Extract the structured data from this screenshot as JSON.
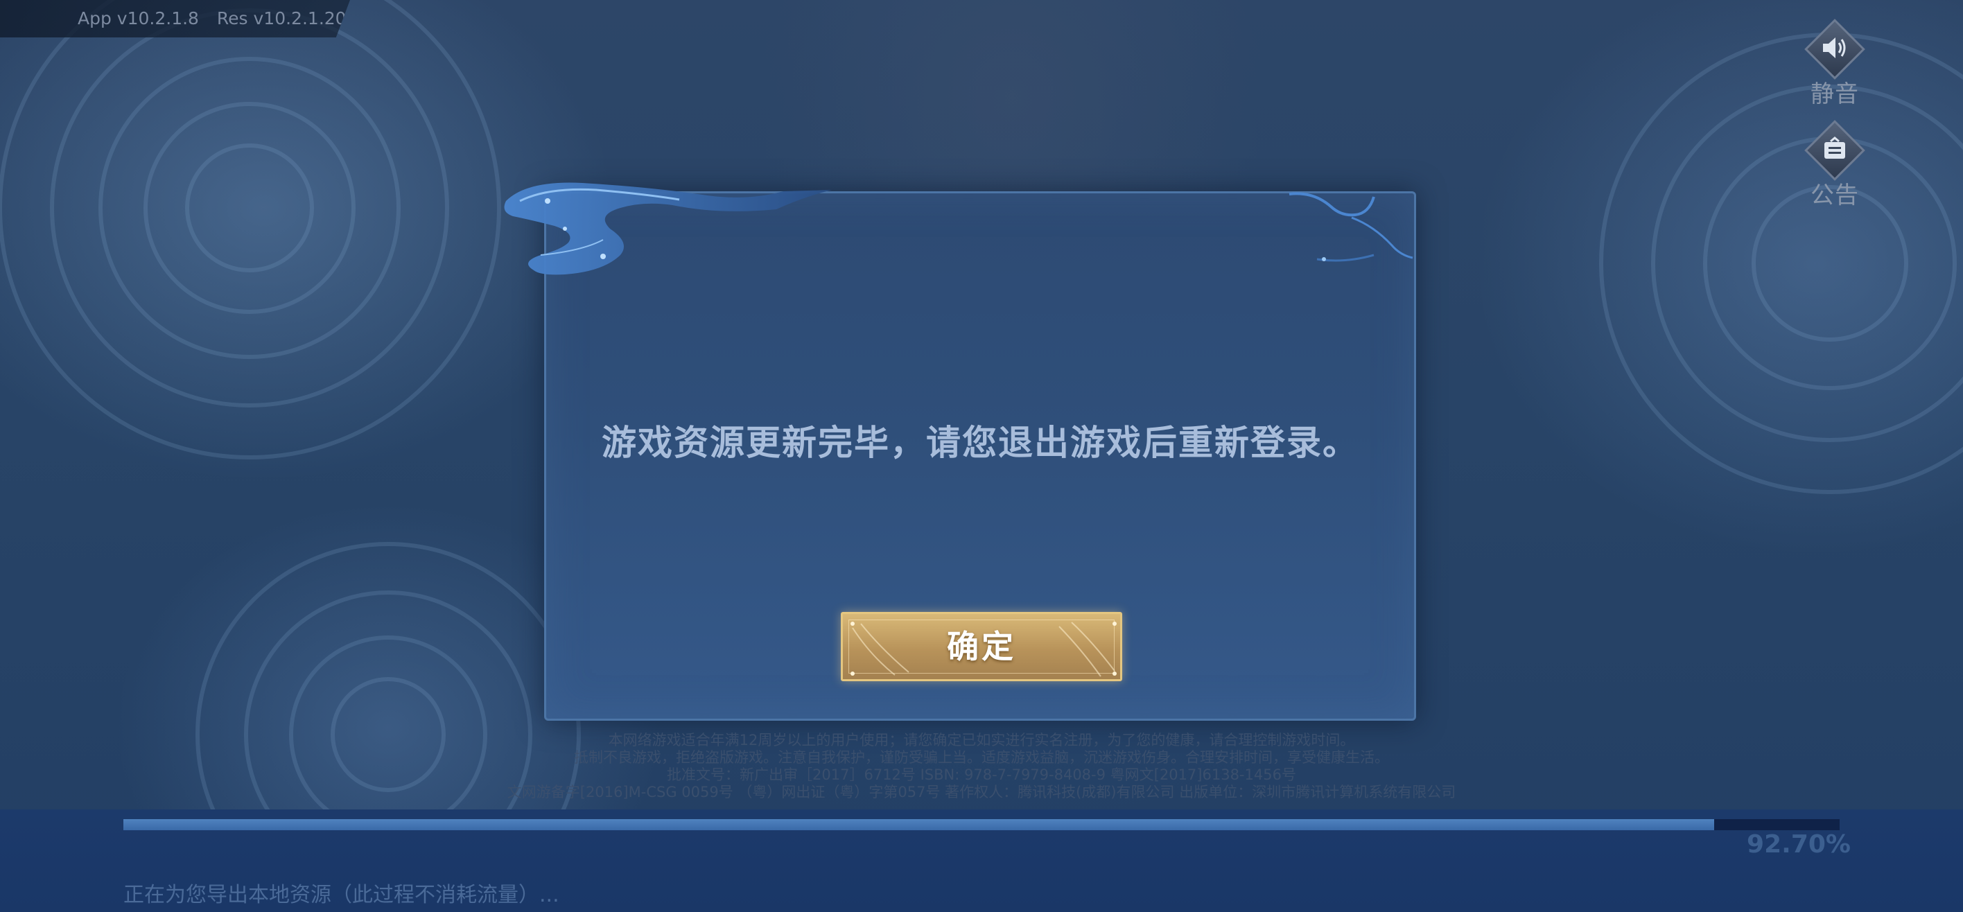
{
  "version": {
    "app": "App v10.2.1.8",
    "res": "Res v10.2.1.20"
  },
  "side_buttons": {
    "mute_label": "静音",
    "notice_label": "公告"
  },
  "dialog": {
    "message": "游戏资源更新完毕，请您退出游戏后重新登录。",
    "confirm_label": "确定"
  },
  "disclaimer": {
    "lines": [
      "本网络游戏适合年满12周岁以上的用户使用；请您确定已如实进行实名注册，为了您的健康，请合理控制游戏时间。",
      "抵制不良游戏，拒绝盗版游戏。注意自我保护，谨防受骗上当。适度游戏益脑，沉迷游戏伤身。合理安排时间，享受健康生活。",
      "批准文号：新广出审［2017］6712号 ISBN: 978-7-7979-8408-9 粤网文[2017]6138-1456号",
      "文网游备字[2016]M-CSG 0059号 （粤）网出证（粤）字第057号 著作权人：腾讯科技(成都)有限公司 出版单位：深圳市腾讯计算机系统有限公司"
    ]
  },
  "progress": {
    "fraction": 0.927,
    "percent_text": "92.70%",
    "status_text": "正在为您导出本地资源（此过程不消耗流量）..."
  },
  "colors": {
    "dialog_border": "#4c75a6",
    "dialog_text": "#a8bddb",
    "button_gold": "#d9b978",
    "progress_fill": "#4f82bf",
    "progress_track": "#0f2248"
  },
  "icons": {
    "mute": "speaker-icon",
    "notice": "notice-board-icon"
  }
}
